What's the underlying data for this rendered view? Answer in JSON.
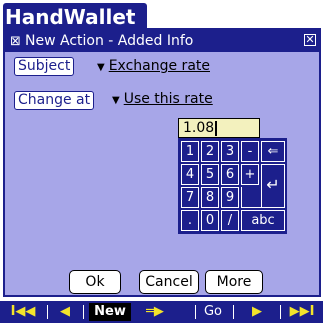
{
  "app": {
    "title": "HandWallet"
  },
  "dialog": {
    "title": "New Action - Added Info",
    "title_glyph": "⊠",
    "close_glyph": "✕"
  },
  "fields": {
    "subject_label": "Subject",
    "subject_value": "Exchange rate",
    "change_label": "Change at",
    "change_value": "Use this rate",
    "trigger_arrow": "▼",
    "rate_value": "1.08"
  },
  "keypad": {
    "keys": [
      "1",
      "2",
      "3",
      "-",
      "⇐",
      "4",
      "5",
      "6",
      "+",
      "↵",
      "7",
      "8",
      "9",
      ".",
      "0",
      "/",
      "abc"
    ]
  },
  "buttons": {
    "ok": "Ok",
    "cancel": "Cancel",
    "more": "More"
  },
  "toolbar": {
    "first": "I◀◀",
    "prev": "◀",
    "new": "New",
    "mid": "═▶",
    "go": "Go",
    "next": "▶",
    "last": "▶▶I"
  },
  "colors": {
    "accent": "#1c1f8c",
    "background": "#a7a6e8",
    "field": "#f3f1be"
  }
}
